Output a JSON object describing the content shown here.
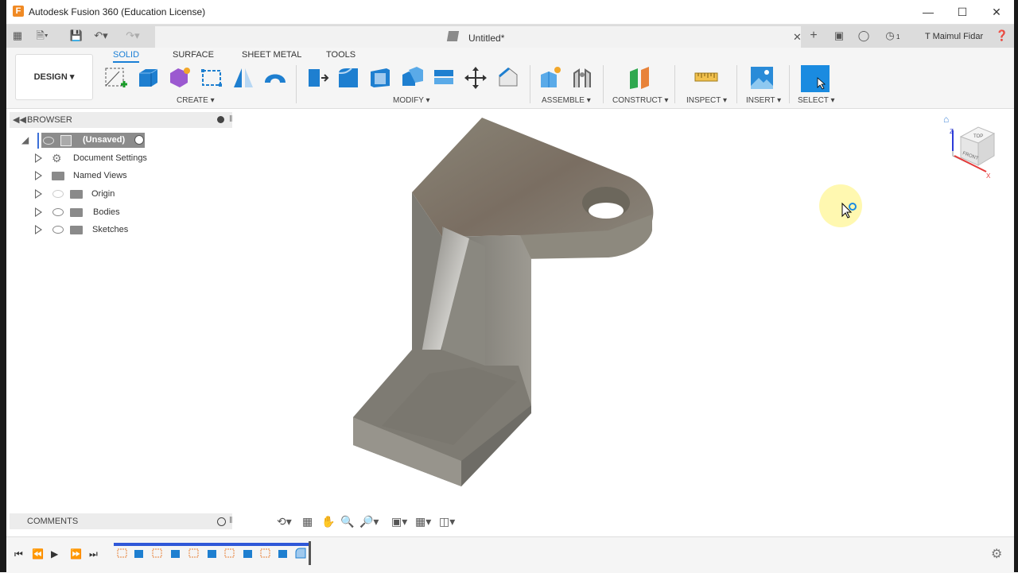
{
  "window": {
    "title": "Autodesk Fusion 360 (Education License)",
    "app_icon_letter": "F"
  },
  "tabbar": {
    "document_title": "Untitled*",
    "user_name": "T Maimul Fidar",
    "notification_count": "1"
  },
  "ribbon": {
    "workspace": "DESIGN",
    "tabs": [
      "SOLID",
      "SURFACE",
      "SHEET METAL",
      "TOOLS"
    ],
    "active_tab": "SOLID",
    "groups": [
      "CREATE",
      "MODIFY",
      "ASSEMBLE",
      "CONSTRUCT",
      "INSPECT",
      "INSERT",
      "SELECT"
    ]
  },
  "browser": {
    "title": "BROWSER",
    "root": "(Unsaved)",
    "items": [
      "Document Settings",
      "Named Views",
      "Origin",
      "Bodies",
      "Sketches"
    ]
  },
  "comments": {
    "title": "COMMENTS"
  },
  "viewcube": {
    "top": "TOP",
    "front": "FRONT",
    "axis_z": "Z",
    "axis_x": "X"
  },
  "colors": {
    "accent": "#1a7fd6",
    "timeline": "#2f58d8",
    "body": "#8e887b"
  }
}
